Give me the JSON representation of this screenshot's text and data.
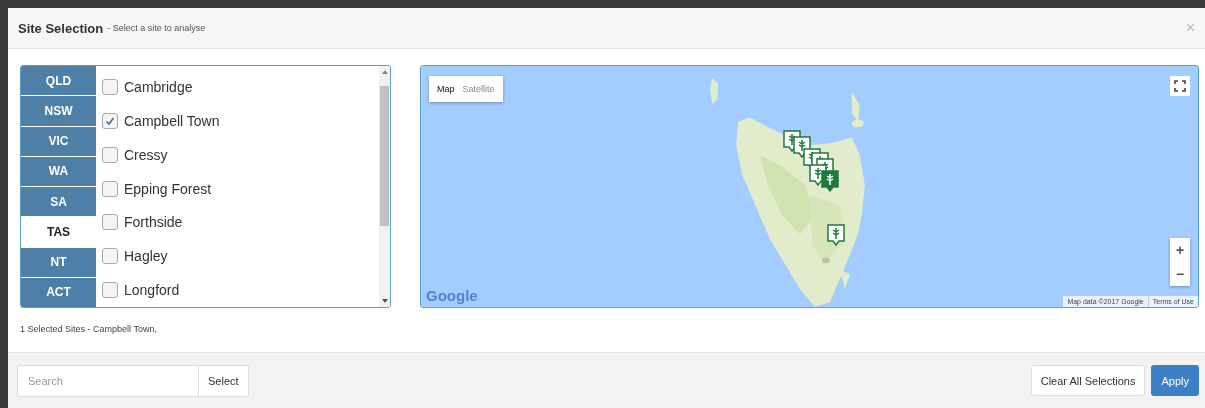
{
  "dialog": {
    "title": "Site Selection",
    "subtitle": "- Select a site to analyse",
    "close": "×"
  },
  "states": [
    {
      "label": "QLD",
      "selected": false
    },
    {
      "label": "NSW",
      "selected": false
    },
    {
      "label": "VIC",
      "selected": false
    },
    {
      "label": "WA",
      "selected": false
    },
    {
      "label": "SA",
      "selected": false
    },
    {
      "label": "TAS",
      "selected": true
    },
    {
      "label": "NT",
      "selected": false
    },
    {
      "label": "ACT",
      "selected": false
    }
  ],
  "sites": [
    {
      "name": "Cambridge",
      "checked": false
    },
    {
      "name": "Campbell Town",
      "checked": true
    },
    {
      "name": "Cressy",
      "checked": false
    },
    {
      "name": "Epping Forest",
      "checked": false
    },
    {
      "name": "Forthside",
      "checked": false
    },
    {
      "name": "Hagley",
      "checked": false
    },
    {
      "name": "Longford",
      "checked": false
    }
  ],
  "selection_summary": "1 Selected Sites - Campbell Town,",
  "map": {
    "map_types": [
      {
        "label": "Map",
        "selected": true
      },
      {
        "label": "Satellite",
        "selected": false
      }
    ],
    "logo": "Google",
    "zoom_in": "+",
    "zoom_out": "−",
    "attribution": "Map data ©2017 Google",
    "terms": "Terms of Use"
  },
  "footer": {
    "search_placeholder": "Search",
    "select": "Select",
    "clear": "Clear All Selections",
    "apply": "Apply"
  }
}
